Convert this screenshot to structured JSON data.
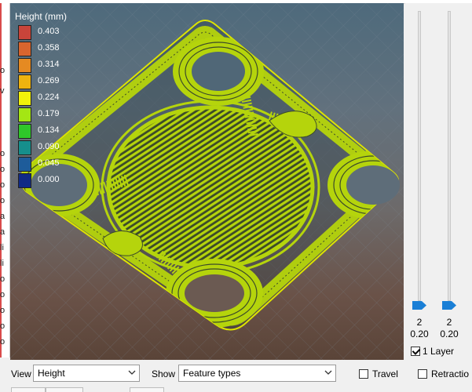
{
  "left_panel": {
    "chars": [
      "o",
      "v",
      "o",
      "o",
      "o",
      "o",
      "a",
      "a",
      "li",
      "li",
      "o",
      "o",
      "o",
      "o",
      "o"
    ]
  },
  "legend": {
    "title": "Height (mm)",
    "entries": [
      {
        "value": "0.403",
        "color": "#c8443a"
      },
      {
        "value": "0.358",
        "color": "#d9652e"
      },
      {
        "value": "0.314",
        "color": "#e58a22"
      },
      {
        "value": "0.269",
        "color": "#eeb30f"
      },
      {
        "value": "0.224",
        "color": "#f2f20a"
      },
      {
        "value": "0.179",
        "color": "#a4e614"
      },
      {
        "value": "0.134",
        "color": "#2fc82a"
      },
      {
        "value": "0.090",
        "color": "#168f8c"
      },
      {
        "value": "0.045",
        "color": "#1e5c9a"
      },
      {
        "value": "0.000",
        "color": "#102a86"
      }
    ]
  },
  "layer_slider": {
    "upper": {
      "layer": "2",
      "height": "0.20"
    },
    "lower": {
      "layer": "2",
      "height": "0.20"
    },
    "one_layer": {
      "label": "1 Layer",
      "checked": true
    }
  },
  "toolbar": {
    "view_label": "View",
    "view_value": "Height",
    "show_label": "Show",
    "show_value": "Feature types",
    "travel_label": "Travel",
    "travel_checked": false,
    "retraction_label": "Retractio",
    "retraction_checked": false
  },
  "colors": {
    "accent": "#1a7fd6",
    "print": "#b5d40c",
    "print_edge": "#dde400"
  }
}
